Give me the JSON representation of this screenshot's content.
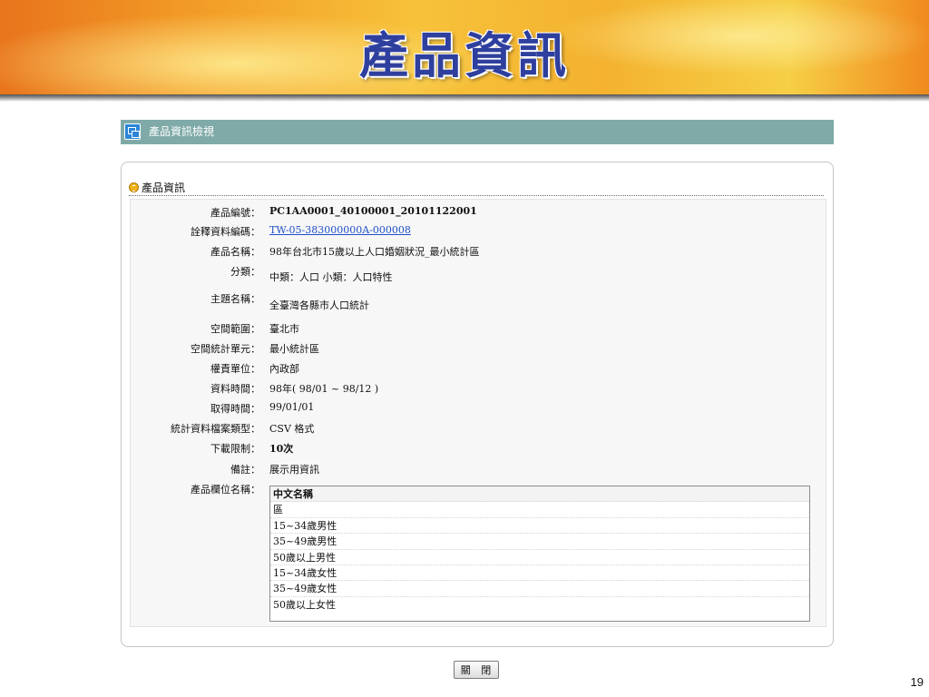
{
  "slide": {
    "title": "產品資訊",
    "page_number": "19"
  },
  "view_header": {
    "label": "產品資訊檢視",
    "icon": "window-icon"
  },
  "section": {
    "title": "產品資訊",
    "icon": "bullet-icon"
  },
  "fields": [
    {
      "label": "產品編號：",
      "value": "PC1AA0001_40100001_20101122001"
    },
    {
      "label": "詮釋資料編碼：",
      "value": "TW-05-383000000A-000008"
    },
    {
      "label": "產品名稱：",
      "value": "98年台北市15歲以上人口婚姻狀況_最小統計區"
    },
    {
      "label": "分類：",
      "value": "中類：人口 小類：人口特性"
    },
    {
      "label": "主題名稱：",
      "value": "全臺灣各縣市人口統計"
    },
    {
      "label": "空間範圍：",
      "value": "臺北市"
    },
    {
      "label": "空間統計單元：",
      "value": "最小統計區"
    },
    {
      "label": "權責單位：",
      "value": "內政部"
    },
    {
      "label": "資料時間：",
      "value": "98年( 98/01 ~ 98/12 )"
    },
    {
      "label": "取得時間：",
      "value": "99/01/01"
    },
    {
      "label": "統計資料檔案類型：",
      "value": "CSV 格式"
    },
    {
      "label": "下載限制：",
      "value": "10次"
    },
    {
      "label": "備註：",
      "value": "展示用資訊"
    },
    {
      "label": "產品欄位名稱：",
      "value": ""
    }
  ],
  "column_names": {
    "header": "中文名稱",
    "items": [
      "區",
      "15~34歲男性",
      "35~49歲男性",
      "50歲以上男性",
      "15~34歲女性",
      "35~49歲女性",
      "50歲以上女性"
    ]
  },
  "close_button": {
    "label": "關 閉"
  },
  "colors": {
    "title_text": "#2f3f9e",
    "header_bar": "#7faaa8",
    "link": "#1f4fc8"
  }
}
